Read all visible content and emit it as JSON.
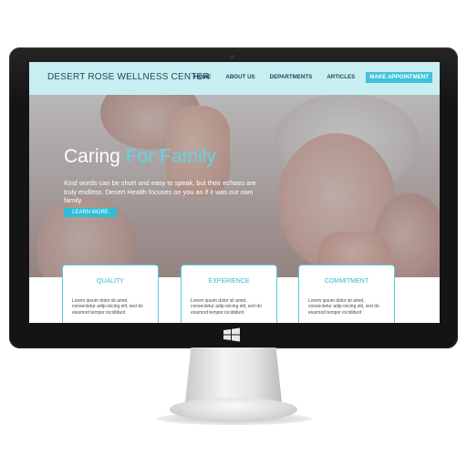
{
  "site": {
    "brand": "DESERT ROSE WELLNESS CENTER",
    "nav": [
      "HOME",
      "ABOUT US",
      "DEPARTMENTS",
      "ARTICLES"
    ],
    "cta": "MAKE APPOINTMENT"
  },
  "hero": {
    "title_main": "Caring ",
    "title_accent": "For Family",
    "text": "Kind words can be short and easy to speak, but their echoes are truly endless. Desert Health focuses on you as if it was our own family.",
    "button": "LEARN MORE"
  },
  "features": [
    {
      "title": "QUALITY",
      "text": "Lorem ipsum dolor sit amet, consectetur adip-isicing elit, sed do eiusmod tempor incididunt"
    },
    {
      "title": "EXPERIENCE",
      "text": "Lorem ipsum dolor sit amet, consectetur adip-isicing elit, sed do eiusmod tempor incididunt"
    },
    {
      "title": "COMMITMENT",
      "text": "Lorem ipsum dolor sit amet, consectetur adip-isicing elit, sed do eiusmod tempor incididunt"
    }
  ],
  "colors": {
    "header_bg": "#c9eef2",
    "accent": "#2ebfd8",
    "brand_text": "#1d4a57"
  },
  "icons": {
    "monitor_logo": "windows-logo-icon"
  }
}
